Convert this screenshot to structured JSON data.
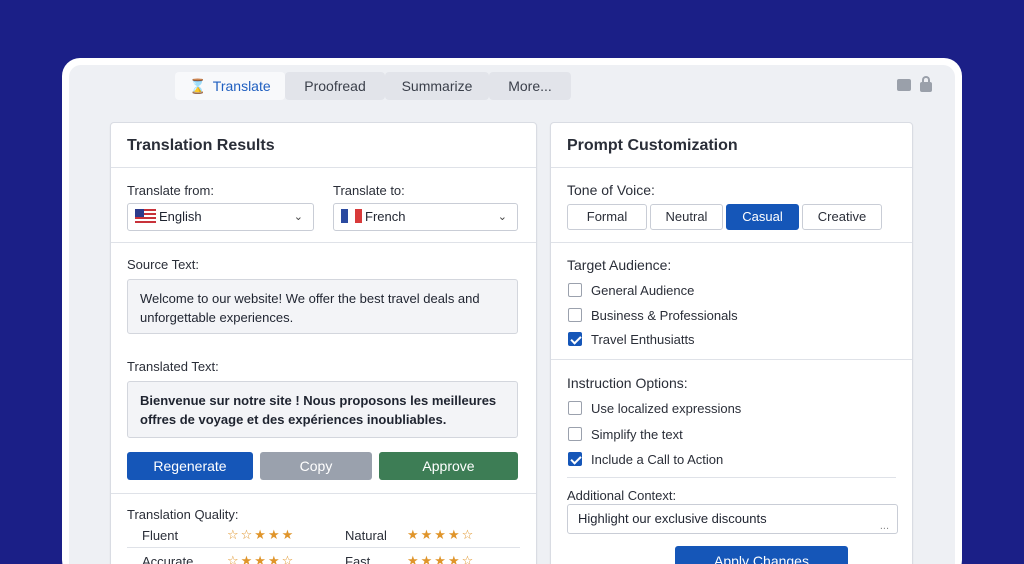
{
  "tabs": [
    {
      "label": "Translate",
      "active": true
    },
    {
      "label": "Proofread",
      "active": false
    },
    {
      "label": "Summarize",
      "active": false
    },
    {
      "label": "More...",
      "active": false
    }
  ],
  "left": {
    "title": "Translation Results",
    "from_label": "Translate from:",
    "from_value": "English",
    "to_label": "Translate to:",
    "to_value": "French",
    "source_label": "Source Text:",
    "source_text": "Welcome to our website! We offer the best travel deals and unforgettable experiences.",
    "translated_label": "Translated Text:",
    "translated_text": "Bienvenue sur notre site ! Nous proposons les meilleures offres de voyage et des expériences inoubliables.",
    "buttons": {
      "regenerate": "Regenerate",
      "copy": "Copy",
      "approve": "Approve"
    },
    "quality_label": "Translation Quality:",
    "quality": [
      {
        "name": "Fluent",
        "stars": "☆☆★★★"
      },
      {
        "name": "Natural",
        "stars": "★★★★☆"
      },
      {
        "name": "Accurate",
        "stars": "☆★★★☆"
      },
      {
        "name": "Fast",
        "stars": "★★★★☆"
      }
    ]
  },
  "right": {
    "title": "Prompt Customization",
    "tone_label": "Tone of Voice:",
    "tones": [
      "Formal",
      "Neutral",
      "Casual",
      "Creative"
    ],
    "tone_selected": "Casual",
    "audience_label": "Target Audience:",
    "audience": [
      {
        "label": "General Audience",
        "checked": false
      },
      {
        "label": "Business & Professionals",
        "checked": false
      },
      {
        "label": "Travel Enthusiatts",
        "checked": true
      }
    ],
    "instruction_label": "Instruction Options:",
    "instructions": [
      {
        "label": "Use localized expressions",
        "checked": false
      },
      {
        "label": "Simplify the text",
        "checked": false
      },
      {
        "label": "Include a Call to Action",
        "checked": true
      }
    ],
    "context_label": "Additional Context:",
    "context_value": "Highlight our exclusive discounts",
    "apply_label": "Apply Changes"
  },
  "colors": {
    "background": "#1b1f87",
    "accent": "#1556b8",
    "approve": "#3d7d55",
    "copy": "#9aa1ad",
    "star": "#e0952b"
  }
}
